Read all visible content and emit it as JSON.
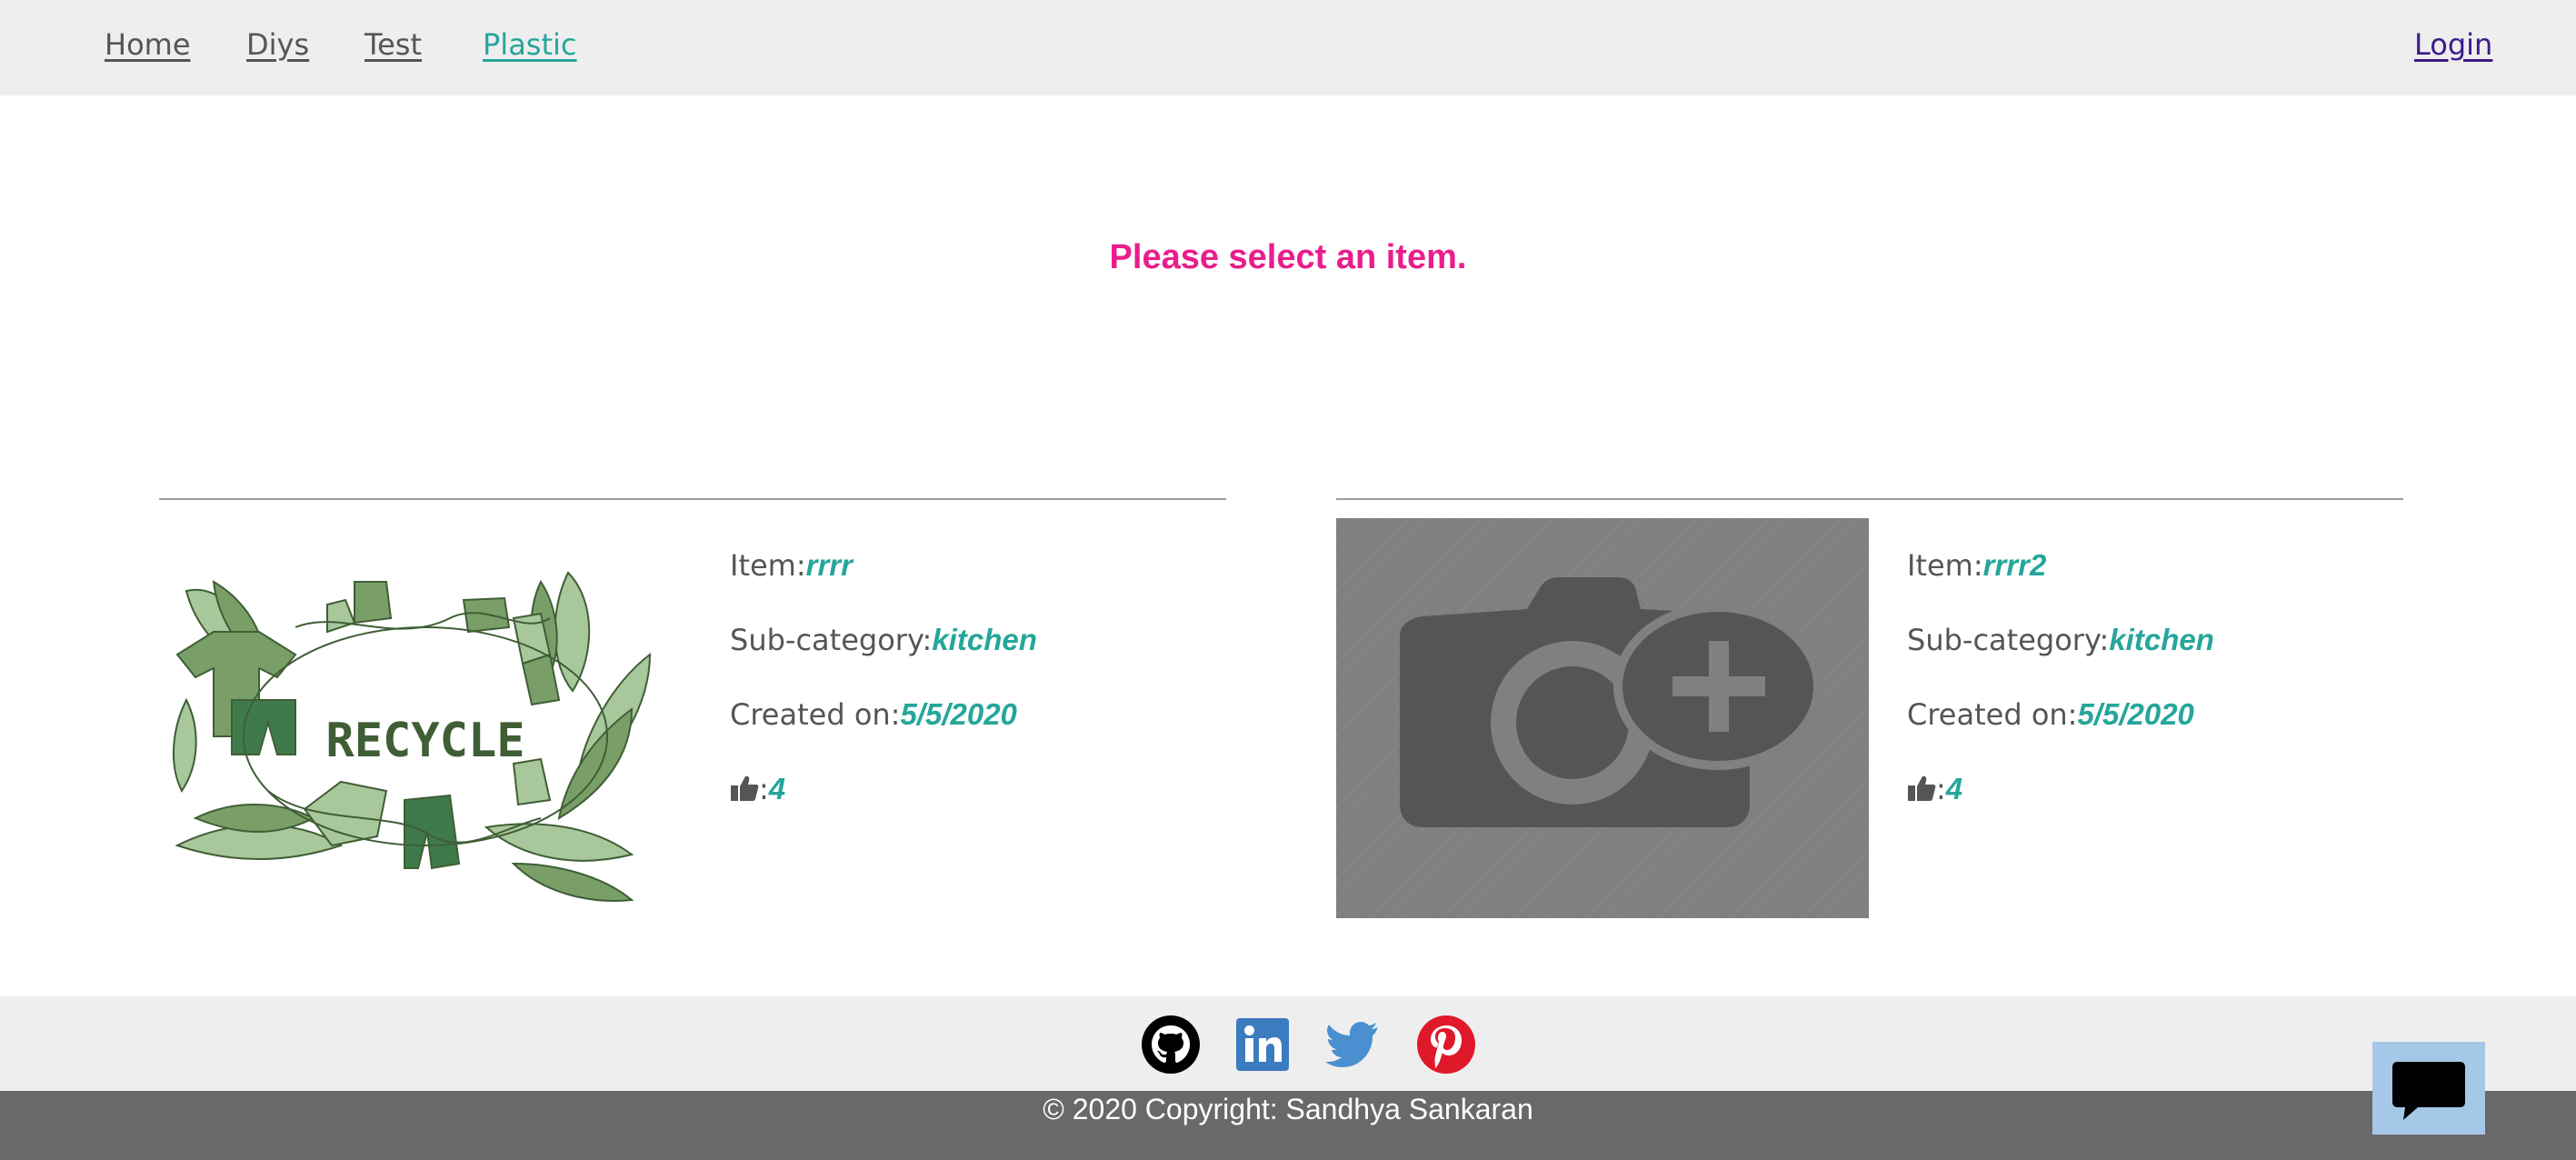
{
  "nav": {
    "items": [
      {
        "label": "Home"
      },
      {
        "label": "Diys"
      },
      {
        "label": "Test"
      },
      {
        "label": "Plastic"
      }
    ],
    "active": "Plastic",
    "login_label": "Login"
  },
  "message": "Please select an item.",
  "labels": {
    "item": "Item:",
    "subcategory": "Sub-category:",
    "created": "Created on:",
    "likes_sep": ":"
  },
  "cards": [
    {
      "image_icon": "recycle-illustration",
      "image_text": "RECYCLE",
      "item": "rrrr",
      "subcategory": "kitchen",
      "created": "5/5/2020",
      "likes": "4"
    },
    {
      "image_icon": "add-photo-placeholder-icon",
      "item": "rrrr2",
      "subcategory": "kitchen",
      "created": "5/5/2020",
      "likes": "4"
    }
  ],
  "footer": {
    "social": [
      "github-icon",
      "linkedin-icon",
      "twitter-icon",
      "pinterest-icon"
    ],
    "copyright": "© 2020 Copyright: Sandhya Sankaran"
  },
  "colors": {
    "accent": "#26a69a",
    "message": "#e91e8c",
    "navbar_bg": "#eeeeee",
    "footer_bg": "#696969",
    "chat_bg": "#a6c8e8"
  }
}
